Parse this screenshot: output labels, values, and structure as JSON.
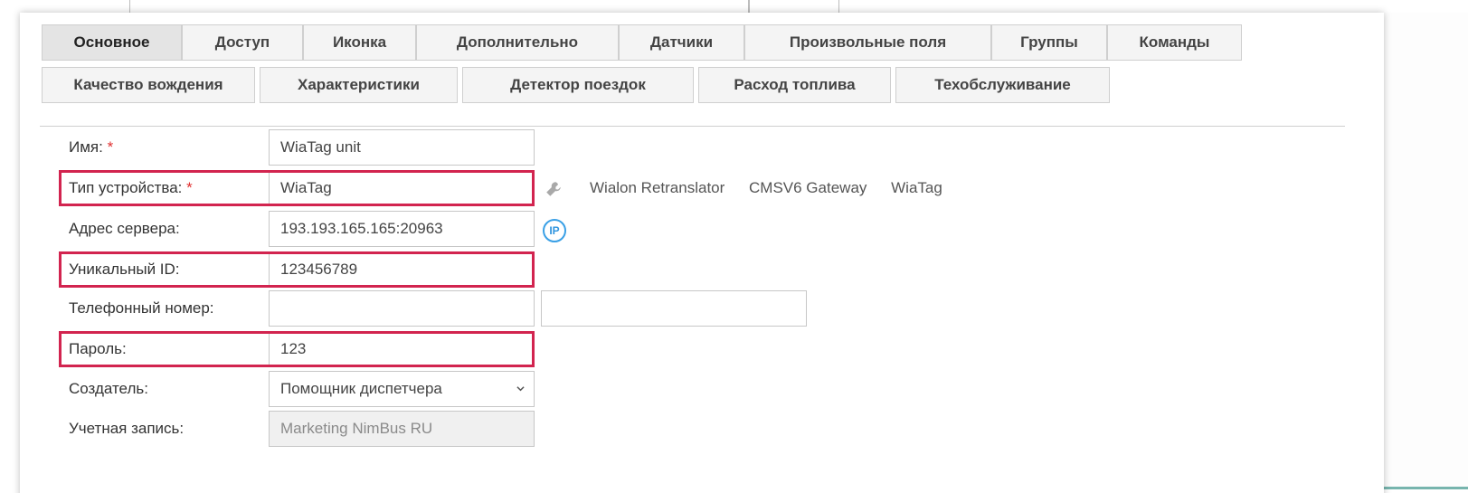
{
  "tabs": [
    {
      "label": "Основное",
      "active": true
    },
    {
      "label": "Доступ"
    },
    {
      "label": "Иконка"
    },
    {
      "label": "Дополнительно"
    },
    {
      "label": "Датчики"
    },
    {
      "label": "Произвольные поля"
    },
    {
      "label": "Группы"
    },
    {
      "label": "Команды"
    },
    {
      "label": "Качество вождения"
    },
    {
      "label": "Характеристики"
    },
    {
      "label": "Детектор поездок"
    },
    {
      "label": "Расход топлива"
    },
    {
      "label": "Техобслуживание"
    }
  ],
  "form": {
    "name": {
      "label": "Имя:",
      "required_mark": "*",
      "value": "WiaTag unit"
    },
    "device_type": {
      "label": "Тип устройства:",
      "required_mark": "*",
      "value": "WiaTag",
      "options": [
        "Wialon Retranslator",
        "CMSV6 Gateway",
        "WiaTag"
      ]
    },
    "server_address": {
      "label": "Адрес сервера:",
      "value": "193.193.165.165:20963",
      "icon_text": "IP"
    },
    "unique_id": {
      "label": "Уникальный ID:",
      "value": "123456789"
    },
    "phone": {
      "label": "Телефонный номер:",
      "value": "",
      "value2": ""
    },
    "password": {
      "label": "Пароль:",
      "value": "123"
    },
    "creator": {
      "label": "Создатель:",
      "value": "Помощник диспетчера"
    },
    "account": {
      "label": "Учетная запись:",
      "value": "Marketing NimBus RU"
    }
  },
  "colors": {
    "highlight": "#d2244f",
    "required": "#e03030",
    "ip_icon": "#2f95df"
  },
  "icons": {
    "wrench": "wrench-icon",
    "ip": "ip-icon",
    "select": "chevron-down-icon"
  }
}
